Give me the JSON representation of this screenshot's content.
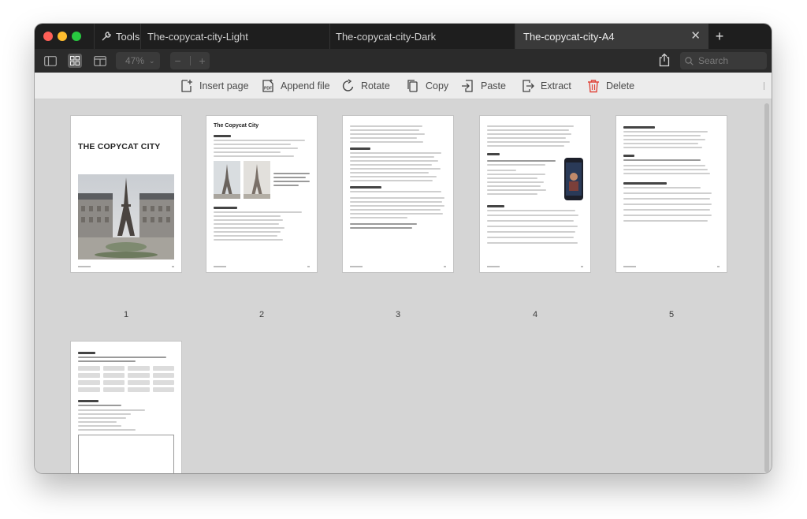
{
  "tabs": [
    {
      "label": "The-copycat-city-Light"
    },
    {
      "label": "The-copycat-city-Dark"
    },
    {
      "label": "The-copycat-city-A4"
    }
  ],
  "tools_label": "Tools",
  "toolbar": {
    "zoom": "47%",
    "search_placeholder": "Search"
  },
  "actions": {
    "insert": "Insert page",
    "append": "Append file",
    "rotate": "Rotate",
    "copy": "Copy",
    "paste": "Paste",
    "extract": "Extract",
    "delete": "Delete"
  },
  "colors": {
    "titlebar": "#1e1e1e",
    "toolbar": "#2b2b2b",
    "actions_bar": "#ececec",
    "workspace": "#d5d5d5",
    "delete_red": "#e0453a"
  },
  "pages": [
    {
      "number": "1",
      "heading": "THE COPYCAT CITY"
    },
    {
      "number": "2",
      "heading": "The Copycat City"
    },
    {
      "number": "3",
      "heading": ""
    },
    {
      "number": "4",
      "heading": ""
    },
    {
      "number": "5",
      "heading": ""
    },
    {
      "number": "",
      "heading": ""
    }
  ]
}
